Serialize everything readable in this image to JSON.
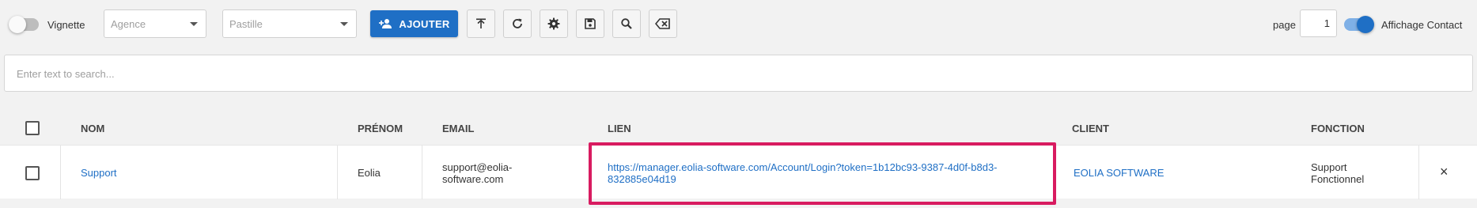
{
  "toolbar": {
    "vignette_label": "Vignette",
    "vignette_on": false,
    "agence_placeholder": "Agence",
    "pastille_placeholder": "Pastille",
    "add_label": "AJOUTER",
    "page_label": "page",
    "page_value": "1",
    "affichage_label": "Affichage Contact",
    "affichage_on": true
  },
  "search": {
    "placeholder": "Enter text to search..."
  },
  "table": {
    "headers": {
      "nom": "NOM",
      "prenom": "PRÉNOM",
      "email": "EMAIL",
      "lien": "LIEN",
      "client": "CLIENT",
      "fonction": "FONCTION"
    },
    "rows": [
      {
        "nom": "Support",
        "prenom": "Eolia",
        "email_line1": "support@eolia-",
        "email_line2": "software.com",
        "lien_line1": "https://manager.eolia-software.com/Account/Login?token=1b12bc93-9387-4d0f-b8d3-",
        "lien_line2": "832885e04d19",
        "client": "EOLIA SOFTWARE",
        "fonction_line1": "Support",
        "fonction_line2": "Fonctionnel",
        "delete_glyph": "×"
      }
    ]
  },
  "colors": {
    "accent": "#1f6fc5",
    "highlight": "#d81b60",
    "background": "#f2f2f2"
  }
}
